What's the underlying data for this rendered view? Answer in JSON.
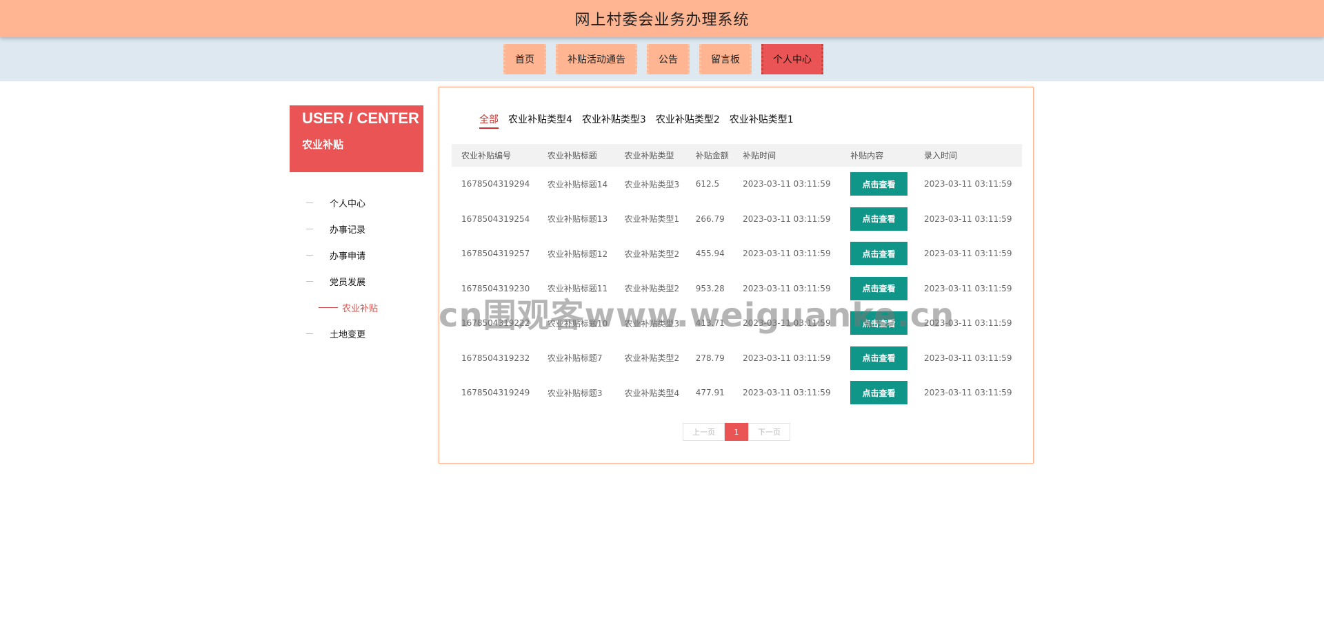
{
  "header": {
    "title": "网上村委会业务办理系统"
  },
  "nav": {
    "items": [
      {
        "label": "首页"
      },
      {
        "label": "补贴活动通告"
      },
      {
        "label": "公告"
      },
      {
        "label": "留言板"
      },
      {
        "label": "个人中心",
        "active": true
      }
    ]
  },
  "sidebar": {
    "heading_en": "USER / CENTER",
    "heading_cn": "农业补贴",
    "items": [
      {
        "label": "个人中心"
      },
      {
        "label": "办事记录"
      },
      {
        "label": "办事申请"
      },
      {
        "label": "党员发展"
      },
      {
        "label": "农业补贴",
        "sub": true,
        "active": true
      },
      {
        "label": "土地变更"
      }
    ]
  },
  "tabs": {
    "items": [
      {
        "label": "全部",
        "active": true
      },
      {
        "label": "农业补贴类型4"
      },
      {
        "label": "农业补贴类型3"
      },
      {
        "label": "农业补贴类型2"
      },
      {
        "label": "农业补贴类型1"
      }
    ]
  },
  "table": {
    "columns": [
      "农业补贴编号",
      "农业补贴标题",
      "农业补贴类型",
      "补贴金额",
      "补贴时间",
      "补贴内容",
      "录入时间"
    ],
    "view_label": "点击查看",
    "rows": [
      {
        "id": "1678504319294",
        "title": "农业补贴标题14",
        "type": "农业补贴类型3",
        "amount": "612.5",
        "time": "2023-03-11 03:11:59",
        "created": "2023-03-11 03:11:59"
      },
      {
        "id": "1678504319254",
        "title": "农业补贴标题13",
        "type": "农业补贴类型1",
        "amount": "266.79",
        "time": "2023-03-11 03:11:59",
        "created": "2023-03-11 03:11:59"
      },
      {
        "id": "1678504319257",
        "title": "农业补贴标题12",
        "type": "农业补贴类型2",
        "amount": "455.94",
        "time": "2023-03-11 03:11:59",
        "created": "2023-03-11 03:11:59"
      },
      {
        "id": "1678504319230",
        "title": "农业补贴标题11",
        "type": "农业补贴类型2",
        "amount": "953.28",
        "time": "2023-03-11 03:11:59",
        "created": "2023-03-11 03:11:59"
      },
      {
        "id": "1678504319222",
        "title": "农业补贴标题10",
        "type": "农业补贴类型3",
        "amount": "413.71",
        "time": "2023-03-11 03:11:59",
        "created": "2023-03-11 03:11:59"
      },
      {
        "id": "1678504319232",
        "title": "农业补贴标题7",
        "type": "农业补贴类型2",
        "amount": "278.79",
        "time": "2023-03-11 03:11:59",
        "created": "2023-03-11 03:11:59"
      },
      {
        "id": "1678504319249",
        "title": "农业补贴标题3",
        "type": "农业补贴类型4",
        "amount": "477.91",
        "time": "2023-03-11 03:11:59",
        "created": "2023-03-11 03:11:59"
      }
    ]
  },
  "pager": {
    "prev": "上一页",
    "current": "1",
    "next": "下一页"
  },
  "watermark": "cn围观客www.weiguanke.cn"
}
